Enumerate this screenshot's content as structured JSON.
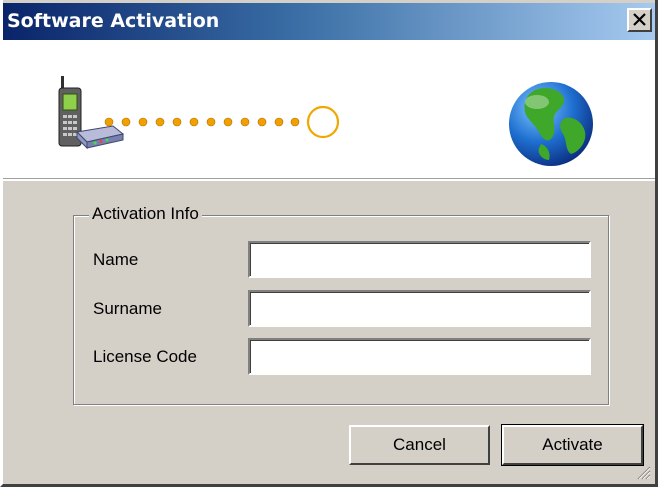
{
  "window": {
    "title": "Software Activation"
  },
  "banner": {
    "left_icon": "phone-modem-icon",
    "connector": "dotted-progress-line",
    "right_icon": "globe-icon"
  },
  "group": {
    "legend": "Activation Info",
    "fields": [
      {
        "label": "Name",
        "value": ""
      },
      {
        "label": "Surname",
        "value": ""
      },
      {
        "label": "License Code",
        "value": ""
      }
    ]
  },
  "buttons": {
    "cancel": "Cancel",
    "activate": "Activate"
  },
  "colors": {
    "titlebar_start": "#0a246a",
    "titlebar_end": "#a6caf0",
    "dialog_face": "#d4d0c8",
    "dot_orange": "#f0a000"
  }
}
